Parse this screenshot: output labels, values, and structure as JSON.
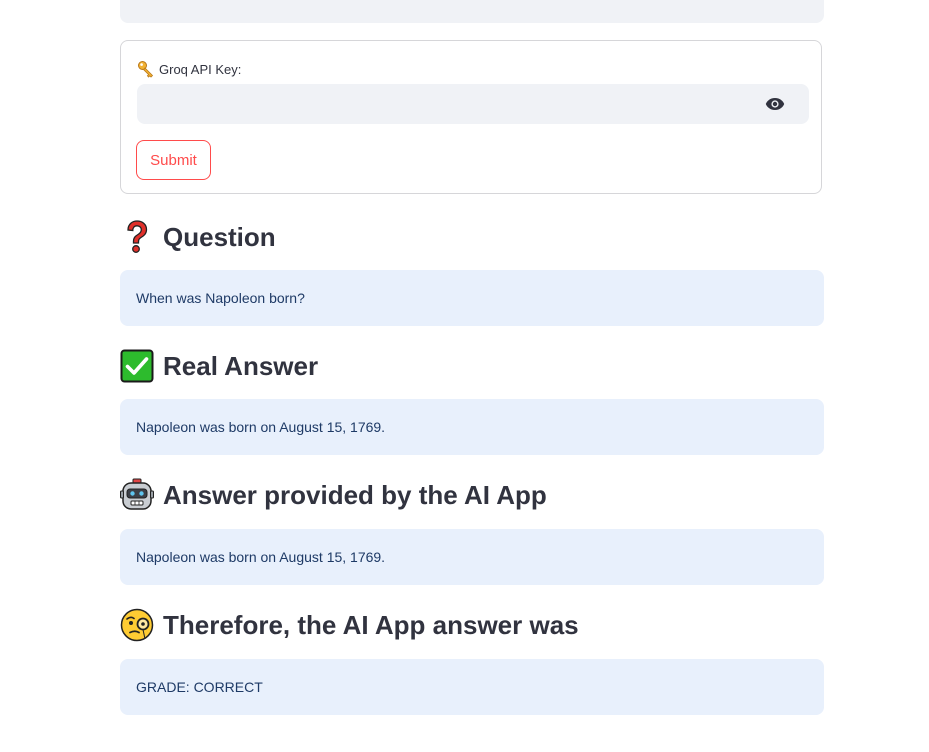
{
  "form": {
    "api_key_label": "Groq API Key:",
    "api_key_value": "",
    "submit_label": "Submit"
  },
  "sections": [
    {
      "title": "Question",
      "icon": "question-mark-icon",
      "content": "When was Napoleon born?"
    },
    {
      "title": "Real Answer",
      "icon": "check-mark-icon",
      "content": "Napoleon was born on August 15, 1769."
    },
    {
      "title": "Answer provided by the AI App",
      "icon": "robot-icon",
      "content": "Napoleon was born on August 15, 1769."
    },
    {
      "title": "Therefore, the AI App answer was",
      "icon": "monocle-face-icon",
      "content": "GRADE: CORRECT"
    }
  ],
  "colors": {
    "accent": "#ff4b4b",
    "info_bg": "#e8f0fc",
    "info_text": "#1e3a66",
    "input_bg": "#f0f2f6"
  }
}
